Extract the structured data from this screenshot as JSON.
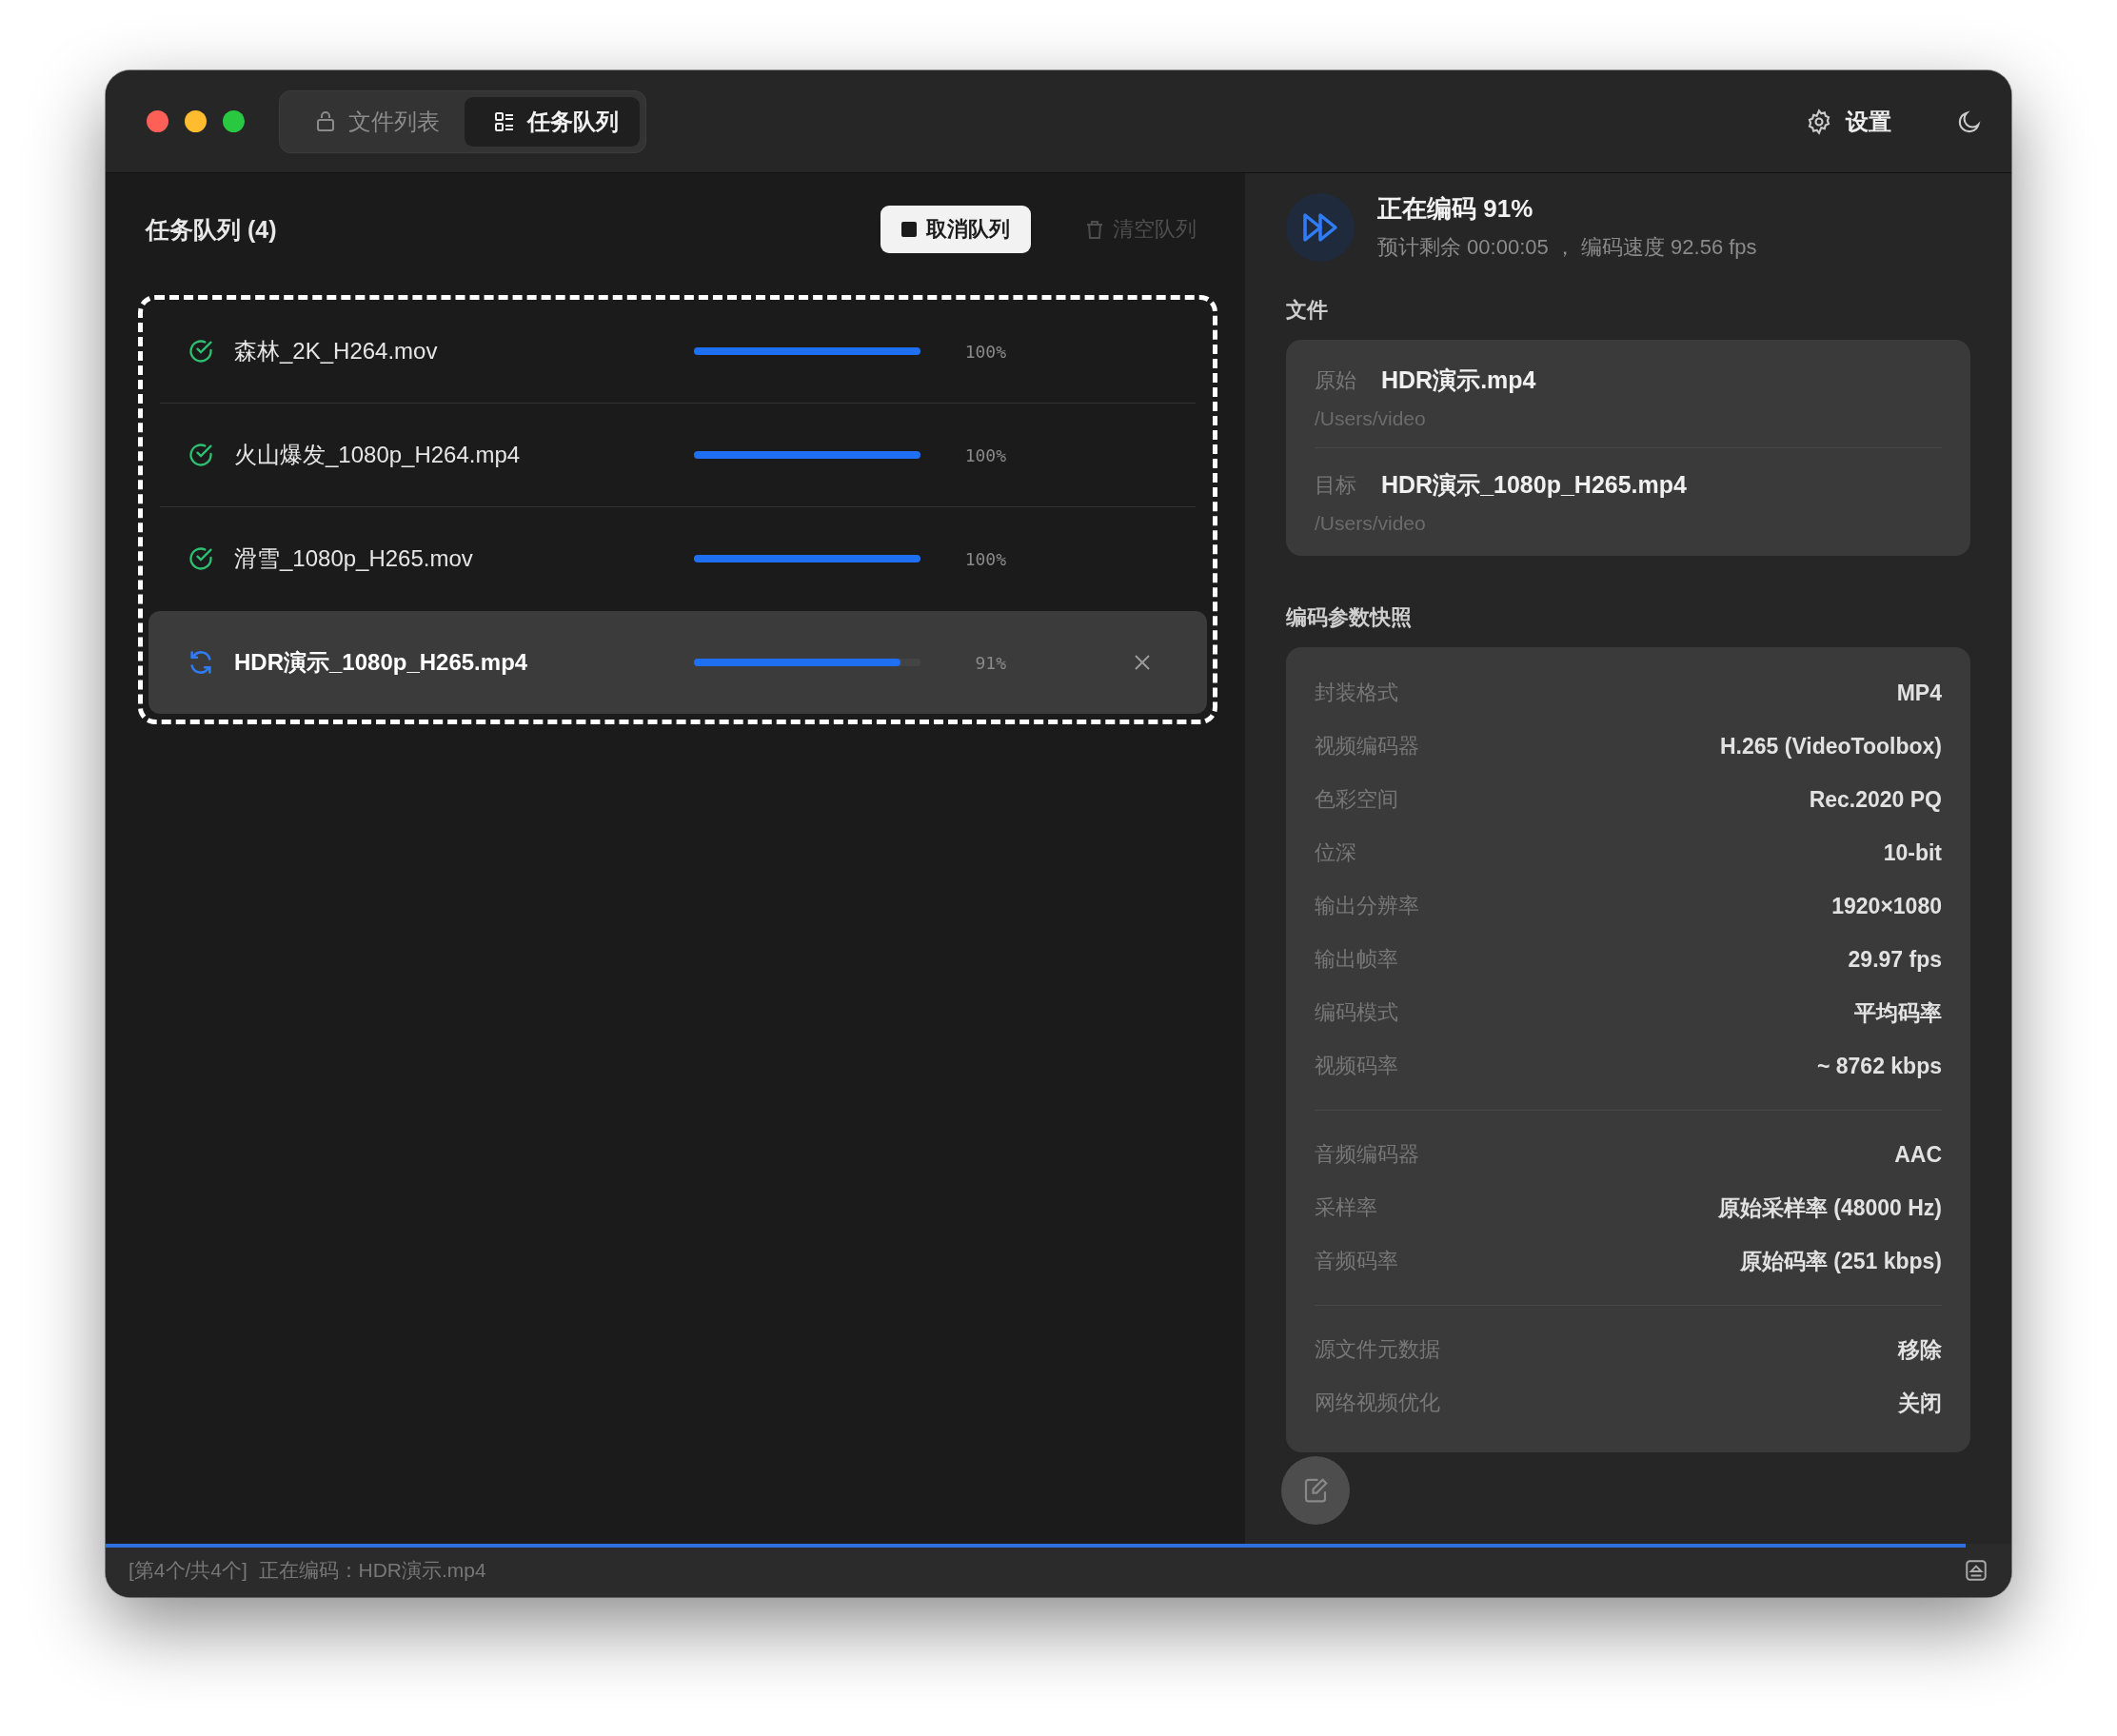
{
  "window": {
    "tabs": [
      {
        "label": "文件列表",
        "selected": false
      },
      {
        "label": "任务队列",
        "selected": true
      }
    ],
    "settings_label": "设置"
  },
  "queue": {
    "title": "任务队列 (4)",
    "buttons": [
      {
        "label": "取消队列",
        "disabled": false
      },
      {
        "label": "清空队列",
        "disabled": true
      }
    ],
    "rows": [
      {
        "name": "森林_2K_H264.mov",
        "kind": "done",
        "level": 1,
        "percent": "100%",
        "selected": false
      },
      {
        "name": "火山爆发_1080p_H264.mp4",
        "kind": "done",
        "level": 1,
        "percent": "100%",
        "selected": false
      },
      {
        "name": "滑雪_1080p_H265.mov",
        "kind": "done",
        "level": 1,
        "percent": "100%",
        "selected": false
      },
      {
        "name": "HDR演示_1080p_H265.mp4",
        "kind": "encoding",
        "level": 0.91,
        "percent": "91%",
        "selected": true
      }
    ]
  },
  "details": {
    "title": "正在编码 91%",
    "subtitle": "预计剩余 00:00:05 ， 编码速度 92.56 fps",
    "files_label": "文件",
    "files": [
      {
        "label": "原始",
        "name": "HDR演示.mp4",
        "path": "/Users/video"
      },
      {
        "label": "目标",
        "name": "HDR演示_1080p_H265.mp4",
        "path": "/Users/video"
      }
    ],
    "params_label": "编码参数快照",
    "param_groups": [
      [
        {
          "label": "封装格式",
          "value": "MP4"
        },
        {
          "label": "视频编码器",
          "value": "H.265 (VideoToolbox)"
        },
        {
          "label": "色彩空间",
          "value": "Rec.2020 PQ"
        },
        {
          "label": "位深",
          "value": "10-bit"
        },
        {
          "label": "输出分辨率",
          "value": "1920×1080"
        },
        {
          "label": "输出帧率",
          "value": "29.97 fps"
        },
        {
          "label": "编码模式",
          "value": "平均码率"
        },
        {
          "label": "视频码率",
          "value": "~ 8762 kbps"
        }
      ],
      [
        {
          "label": "音频编码器",
          "value": "AAC"
        },
        {
          "label": "采样率",
          "value": "原始采样率 (48000 Hz)"
        },
        {
          "label": "音频码率",
          "value": "原始码率 (251 kbps)"
        }
      ],
      [
        {
          "label": "源文件元数据",
          "value": "移除"
        },
        {
          "label": "网络视频优化",
          "value": "关闭"
        }
      ]
    ]
  },
  "status_bar": {
    "text": "[第4个/共4个]  正在编码：HDR演示.mp4",
    "level": 0.976
  }
}
